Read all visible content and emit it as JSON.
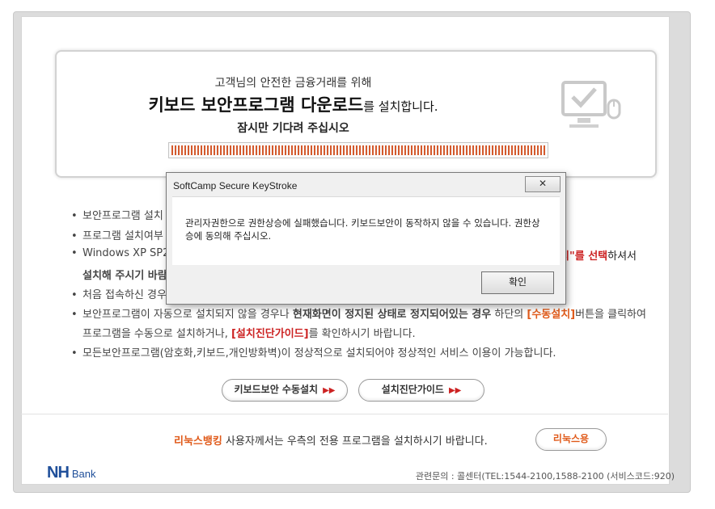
{
  "banner": {
    "line1": "고객님의 안전한 금융거래를 위해",
    "line2_bold": "키보드 보안프로그램 다운로드",
    "line2_rest": "를 설치합니다.",
    "line3": "잠시만 기다려 주십시오",
    "progress": 1.0,
    "icon": "computer-check-mouse-icon"
  },
  "bullets": [
    {
      "prefix": "보안프로그램 설치",
      "text": ""
    },
    {
      "prefix": "프로그램 설치여부",
      "text": ""
    },
    {
      "prefix": "Windows XP SP2",
      "text": "",
      "right_red": "치\"를 선택",
      "right_rest": "하셔서"
    },
    {
      "prefix": "설치해 주시기 바람",
      "text": ""
    },
    {
      "prefix": "처음 접속하신 경우",
      "text": ""
    },
    {
      "prefix": "보안프로그램이 자동으로 설치되지 않을 경우나",
      "mid_bold": "현재화면이 정지된 상태로 정지되어있는 경우",
      "mid_rest": "하단의",
      "red": "[수동설치]",
      "tail": "버튼을 클릭하여"
    },
    {
      "prefix": "프로그램을 수동으로 설치하거나,",
      "red": "[설치진단가이드]",
      "tail": "를 확인하시기 바랍니다."
    },
    {
      "prefix": "모든보안프로그램(암호화,키보드,개인방화벽)이 정상적으로 설치되어야 정상적인 서비스 이용이 가능합니다.",
      "text": ""
    }
  ],
  "buttons": {
    "manual_install": "키보드보안 수동설치",
    "diagnose_guide": "설치진단가이드",
    "linux": "리눅스용"
  },
  "linux_note": {
    "brand": "리눅스뱅킹",
    "text": " 사용자께서는 우측의 전용 프로그램을 설치하시기 바랍니다."
  },
  "footer": {
    "logo_nh": "NH",
    "logo_bank": "Bank",
    "contact": "관련문의 : 콜센터(TEL:1544-2100,1588-2100 (서비스코드:920)"
  },
  "dialog": {
    "title": "SoftCamp Secure KeyStroke",
    "close_icon": "close-icon",
    "message": "관리자권한으로 권한상승에 실패했습니다. 키보드보안이 동작하지 않을 수 있습니다. 권한상승에 동의해 주십시오.",
    "ok_label": "확인"
  },
  "colors": {
    "accent_red": "#c22222",
    "accent_orange": "#e05a1a",
    "brand_blue": "#1f4f9a"
  }
}
